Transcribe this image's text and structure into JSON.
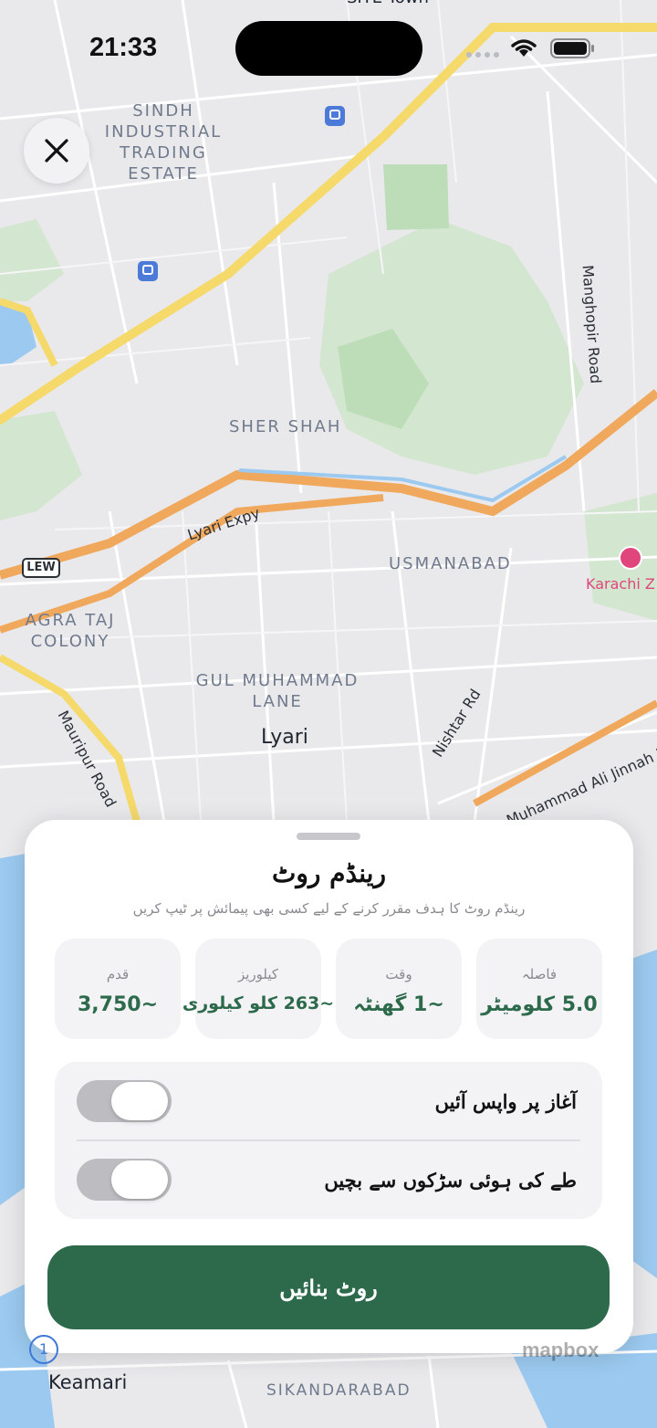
{
  "status_bar": {
    "time": "21:33"
  },
  "map": {
    "labels": {
      "sindh_industrial": "SINDH\nINDUSTRIAL\nTRADING\nESTATE",
      "sher_shah": "SHER SHAH",
      "usmanabad": "USMANABAD",
      "agra_taj": "AGRA TAJ\nCOLONY",
      "gul_muhammad": "GUL MUHAMMAD\nLANE",
      "lyari": "Lyari",
      "keamari": "Keamari",
      "sikandarabad": "SIKANDARABAD",
      "karachi_zoo": "Karachi Z",
      "site_town": "SITE Town"
    },
    "roads": {
      "lyari_expy": "Lyari Expy",
      "manghopir": "Manghopir Road",
      "nishtar": "Nishtar Rd",
      "mauripur": "Mauripur Road",
      "muhammad_ali_jinnah": "Muhammad Ali Jinnah R"
    },
    "badge": "LEW",
    "attribution": "mapbox",
    "colors": {
      "land": "#e9e9ec",
      "park": "#d3e6cf",
      "park_dark": "#bddcb8",
      "highway": "#f5d96b",
      "expressway": "#f0a85c",
      "water": "#9bc9ef",
      "road": "#ffffff"
    }
  },
  "sheet": {
    "title": "رینڈم روٹ",
    "subtitle": "رینڈم روٹ کا ہدف مقرر کرنے کے لیے کسی بھی پیمائش پر ٹیپ کریں",
    "stats": [
      {
        "label": "فاصلہ",
        "value": "5.0 کلومیٹر"
      },
      {
        "label": "وقت",
        "value": "~1 گھنٹہ"
      },
      {
        "label": "کیلوریز",
        "value": "~263 کلو کیلوری"
      },
      {
        "label": "قدم",
        "value": "~3,750"
      }
    ],
    "toggles": [
      {
        "label": "آغاز پر واپس آئیں",
        "on": false
      },
      {
        "label": "طے کی ہوئی سڑکوں سے بچیں",
        "on": false
      }
    ],
    "primary_button": "روٹ بنائیں",
    "accent_color": "#2c6a4b"
  }
}
